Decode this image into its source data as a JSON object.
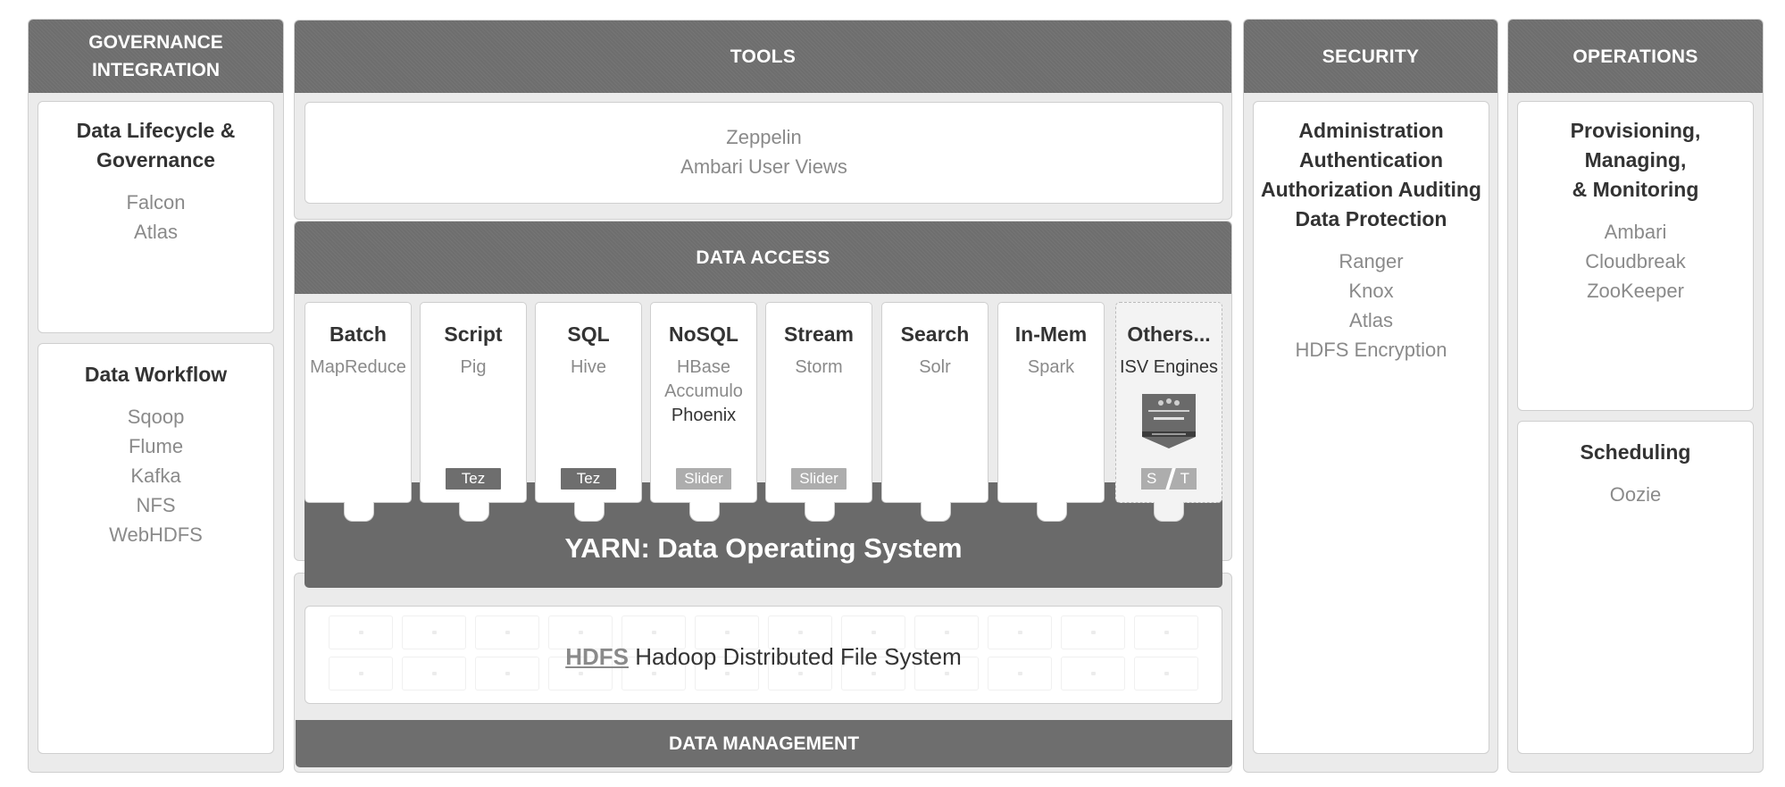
{
  "governance": {
    "header": "GOVERNANCE INTEGRATION",
    "lifecycle": {
      "title": "Data Lifecycle & Governance",
      "items": [
        "Falcon",
        "Atlas"
      ]
    },
    "workflow": {
      "title": "Data Workflow",
      "items": [
        "Sqoop",
        "Flume",
        "Kafka",
        "NFS",
        "WebHDFS"
      ]
    }
  },
  "tools": {
    "header": "TOOLS",
    "items": [
      "Zeppelin",
      "Ambari User Views"
    ]
  },
  "data_access": {
    "header": "DATA ACCESS",
    "engines": [
      {
        "name": "Batch",
        "items": [
          "MapReduce"
        ],
        "badge": ""
      },
      {
        "name": "Script",
        "items": [
          "Pig"
        ],
        "badge": "Tez"
      },
      {
        "name": "SQL",
        "items": [
          "Hive"
        ],
        "badge": "Tez"
      },
      {
        "name": "NoSQL",
        "items": [
          "HBase",
          "Accumulo",
          "Phoenix"
        ],
        "badge": "Slider"
      },
      {
        "name": "Stream",
        "items": [
          "Storm"
        ],
        "badge": "Slider"
      },
      {
        "name": "Search",
        "items": [
          "Solr"
        ],
        "badge": ""
      },
      {
        "name": "In-Mem",
        "items": [
          "Spark"
        ],
        "badge": ""
      },
      {
        "name": "Others...",
        "items": [
          "ISV Engines"
        ],
        "badge": ""
      }
    ],
    "st_badge": {
      "s": "S",
      "t": "T"
    },
    "yarn_title": "YARN: Data Operating System"
  },
  "data_management": {
    "hdfs_abbr": "HDFS",
    "hdfs_label": "Hadoop Distributed File System",
    "header": "DATA MANAGEMENT"
  },
  "security": {
    "header": "SECURITY",
    "title_lines": [
      "Administration",
      "Authentication",
      "Authorization Auditing",
      "Data Protection"
    ],
    "items": [
      "Ranger",
      "Knox",
      "Atlas",
      "HDFS Encryption"
    ]
  },
  "operations": {
    "header": "OPERATIONS",
    "provisioning": {
      "title_lines": [
        "Provisioning, Managing,",
        "& Monitoring"
      ],
      "items": [
        "Ambari",
        "Cloudbreak",
        "ZooKeeper"
      ]
    },
    "scheduling": {
      "title": "Scheduling",
      "items": [
        "Oozie"
      ]
    }
  },
  "colors": {
    "header_bg": "#6e6e6e",
    "panel_bg": "#ebebeb",
    "muted_text": "#8a8a8a",
    "yarn_bg": "#6a6a6a"
  }
}
